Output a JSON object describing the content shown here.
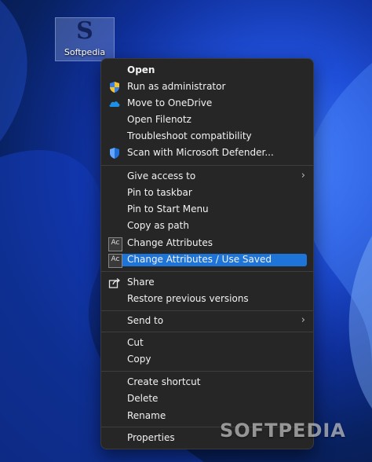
{
  "desktop": {
    "icon_label": "Softpedia",
    "icon_glyph": "S"
  },
  "menu": {
    "group1": [
      {
        "label": "Open",
        "icon": "none"
      },
      {
        "label": "Run as administrator",
        "icon": "uac-shield-icon"
      },
      {
        "label": "Move to OneDrive",
        "icon": "onedrive-cloud-icon"
      },
      {
        "label": "Open Filenotz",
        "icon": "none"
      },
      {
        "label": "Troubleshoot compatibility",
        "icon": "none"
      },
      {
        "label": "Scan with Microsoft Defender...",
        "icon": "defender-shield-icon"
      }
    ],
    "group2": [
      {
        "label": "Give access to",
        "submenu": true
      },
      {
        "label": "Pin to taskbar"
      },
      {
        "label": "Pin to Start Menu"
      },
      {
        "label": "Copy as path"
      },
      {
        "label": "Change Attributes",
        "icon": "ac-icon",
        "icon_text": "Ac"
      },
      {
        "label": "Change Attributes / Use Saved",
        "icon": "ac-icon",
        "icon_text": "Ac",
        "highlighted": true
      }
    ],
    "group3": [
      {
        "label": "Share",
        "icon": "share-icon"
      },
      {
        "label": "Restore previous versions"
      }
    ],
    "group4": [
      {
        "label": "Send to",
        "submenu": true
      }
    ],
    "group5": [
      {
        "label": "Cut"
      },
      {
        "label": "Copy"
      }
    ],
    "group6": [
      {
        "label": "Create shortcut"
      },
      {
        "label": "Delete"
      },
      {
        "label": "Rename"
      }
    ],
    "group7": [
      {
        "label": "Properties"
      }
    ],
    "submenu_chevron": "›"
  },
  "watermark": "SOFTPEDIA",
  "colors": {
    "highlight": "#1f74d8",
    "menu_bg": "#262626",
    "accent_blue": "#1d64e0"
  }
}
